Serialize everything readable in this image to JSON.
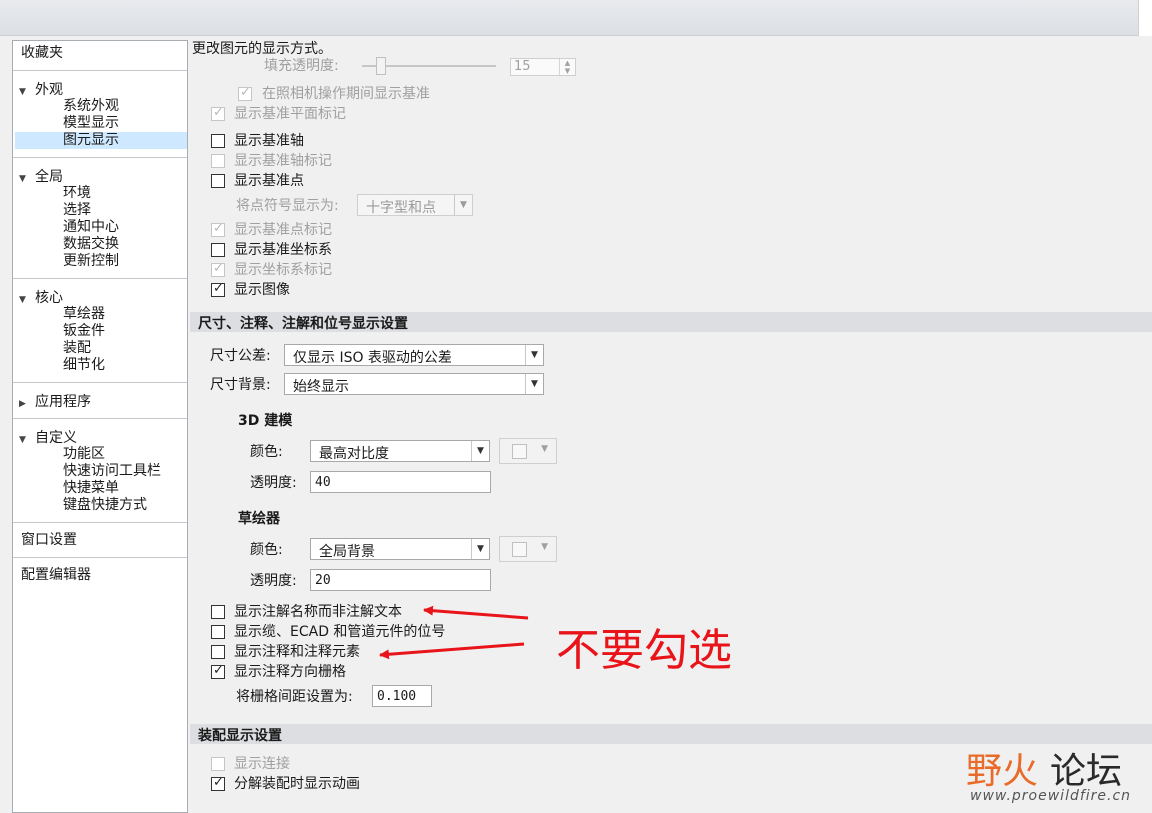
{
  "nav": {
    "favorites": "收藏夹",
    "appearance": {
      "label": "外观",
      "items": [
        "系统外观",
        "模型显示",
        "图元显示"
      ]
    },
    "global": {
      "label": "全局",
      "items": [
        "环境",
        "选择",
        "通知中心",
        "数据交换",
        "更新控制"
      ]
    },
    "core": {
      "label": "核心",
      "items": [
        "草绘器",
        "钣金件",
        "装配",
        "细节化"
      ]
    },
    "apps": {
      "label": "应用程序"
    },
    "customize": {
      "label": "自定义",
      "items": [
        "功能区",
        "快速访问工具栏",
        "快捷菜单",
        "键盘快捷方式"
      ]
    },
    "window_settings": "窗口设置",
    "config_editor": "配置编辑器"
  },
  "main": {
    "intro": "更改图元的显示方式。",
    "fill_transparency_label": "填充透明度:",
    "fill_transparency_value": "15",
    "opt_show_datum_during_camera": "在照相机操作期间显示基准",
    "opt_show_datum_plane_tags": "显示基准平面标记",
    "opt_show_datum_axes": "显示基准轴",
    "opt_show_datum_axis_tags": "显示基准轴标记",
    "opt_show_datum_points": "显示基准点",
    "point_symbol_label": "将点符号显示为:",
    "point_symbol_value": "十字型和点",
    "opt_show_datum_point_tags": "显示基准点标记",
    "opt_show_datum_csys": "显示基准坐标系",
    "opt_show_csys_tags": "显示坐标系标记",
    "opt_show_images": "显示图像"
  },
  "dim": {
    "section_title": "尺寸、注释、注解和位号显示设置",
    "tolerance_label": "尺寸公差:",
    "tolerance_value": "仅显示 ISO 表驱动的公差",
    "background_label": "尺寸背景:",
    "background_value": "始终显示",
    "modeling_title": "3D 建模",
    "modeling_color_label": "颜色:",
    "modeling_color_value": "最高对比度",
    "modeling_transparency_label": "透明度:",
    "modeling_transparency_value": "40",
    "sketcher_title": "草绘器",
    "sketcher_color_label": "颜色:",
    "sketcher_color_value": "全局背景",
    "sketcher_transparency_label": "透明度:",
    "sketcher_transparency_value": "20",
    "opt_annotation_names": "显示注解名称而非注解文本",
    "opt_cable_ecad_piping": "显示缆、ECAD 和管道元件的位号",
    "opt_annotations_elements": "显示注释和注释元素",
    "opt_annotation_grid": "显示注释方向栅格",
    "grid_spacing_label": "将栅格间距设置为:",
    "grid_spacing_value": "0.100"
  },
  "assembly": {
    "section_title": "装配显示设置",
    "opt_show_connections": "显示连接",
    "opt_explode_animation": "分解装配时显示动画"
  },
  "annotation": {
    "text": "不要勾选",
    "color": "#e8141a"
  },
  "watermark": {
    "name_part1": "野火",
    "name_part2": "论坛",
    "url": "www.proewildfire.cn"
  }
}
